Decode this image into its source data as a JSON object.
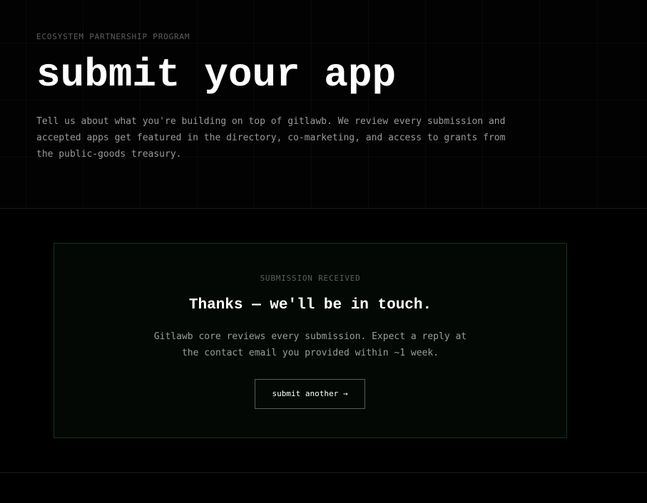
{
  "hero": {
    "eyebrow": "ECOSYSTEM PARTNERSHIP PROGRAM",
    "title": "submit your app",
    "description": "Tell us about what you're building on top of gitlawb. We review every submission and accepted apps get featured in the directory, co-marketing, and access to grants from the public-goods treasury."
  },
  "confirmation": {
    "eyebrow": "SUBMISSION RECEIVED",
    "title": "Thanks — we'll be in touch.",
    "body": "Gitlawb core reviews every submission. Expect a reply at the contact email you provided within ~1 week.",
    "button_label": "submit another →"
  },
  "colors": {
    "background": "#000000",
    "card_border": "#15351c",
    "card_background": "#030805",
    "muted_text": "#9a9a9a",
    "eyebrow_text": "#5e5e5e",
    "heading_text": "#ffffff"
  }
}
